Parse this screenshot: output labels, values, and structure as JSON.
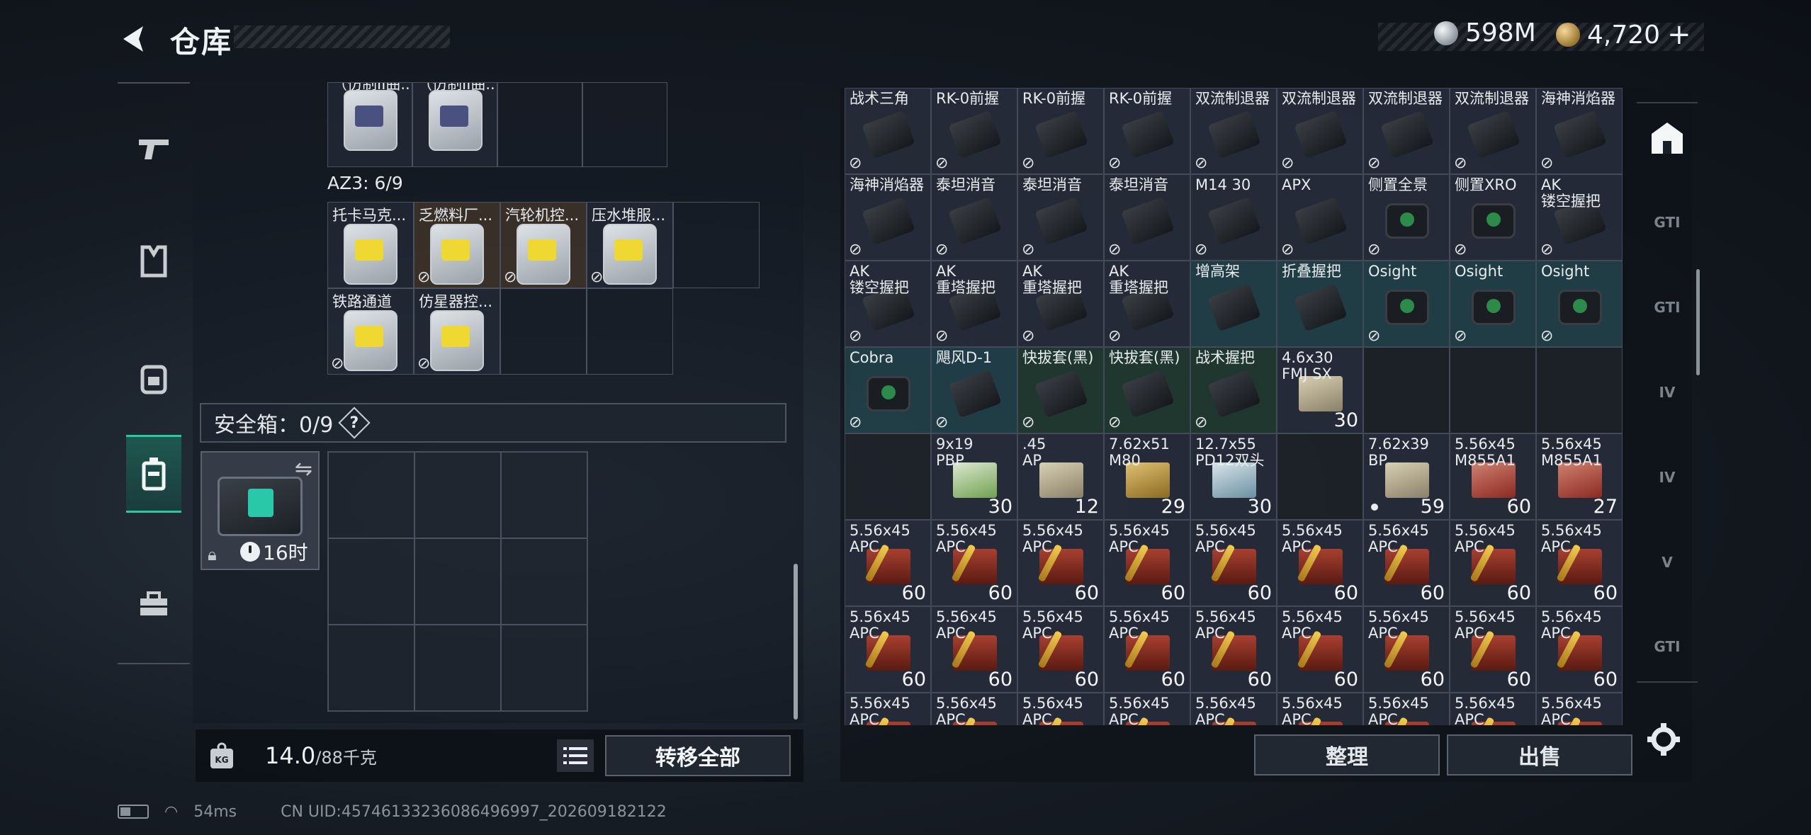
{
  "header": {
    "title": "仓库",
    "currencies": [
      {
        "icon": "silver-coin-icon",
        "value": "598M"
      },
      {
        "icon": "gold-coin-icon",
        "value": "4,720"
      }
    ],
    "add_label": "+"
  },
  "left_rail": {
    "items": [
      {
        "name": "pistol-icon",
        "active": false
      },
      {
        "name": "vest-icon",
        "active": false
      },
      {
        "name": "backpack-icon",
        "active": false
      },
      {
        "name": "safe-case-icon",
        "active": true
      },
      {
        "name": "toolbox-icon",
        "active": false
      }
    ]
  },
  "stash": {
    "top_items": [
      {
        "name": "（仿制II曲...",
        "icon": "keycard-icon",
        "tint": "b",
        "color": "default"
      },
      {
        "name": "（仿制II曲...",
        "icon": "keycard-icon",
        "tint": "b",
        "color": "default"
      }
    ],
    "az3_label": "AZ3: 6/9",
    "az3_items": [
      {
        "name": "托卡马克...",
        "tint": "y",
        "color": "default",
        "nocase": false
      },
      {
        "name": "乏燃料厂...",
        "tint": "y",
        "color": "brown",
        "nocase": true
      },
      {
        "name": "汽轮机控...",
        "tint": "y",
        "color": "brown",
        "nocase": true
      },
      {
        "name": "压水堆服...",
        "tint": "y",
        "color": "default",
        "nocase": true
      },
      {
        "name": "铁路通道",
        "tint": "y",
        "color": "default",
        "nocase": true
      },
      {
        "name": "仿星器控...",
        "tint": "y",
        "color": "default",
        "nocase": true
      }
    ],
    "safe_box": {
      "label": "安全箱：0/9",
      "help": "?",
      "timer": "16时"
    }
  },
  "footer": {
    "weight_current": "14.0",
    "weight_max": "/88千克",
    "transfer_all": "转移全部"
  },
  "inventory": {
    "rows": [
      [
        {
          "name": "战术三角",
          "icon": "part",
          "nocase": true,
          "bg": "default"
        },
        {
          "name": "RK-0前握",
          "icon": "part",
          "nocase": true,
          "bg": "default"
        },
        {
          "name": "RK-0前握",
          "icon": "part",
          "nocase": true,
          "bg": "default"
        },
        {
          "name": "RK-0前握",
          "icon": "part",
          "nocase": true,
          "bg": "default"
        },
        {
          "name": "双流制退器",
          "icon": "part",
          "nocase": true,
          "bg": "default"
        },
        {
          "name": "双流制退器",
          "icon": "part",
          "nocase": true,
          "bg": "default"
        },
        {
          "name": "双流制退器",
          "icon": "part",
          "nocase": true,
          "bg": "default"
        },
        {
          "name": "双流制退器",
          "icon": "part",
          "nocase": true,
          "bg": "default"
        },
        {
          "name": "海神消焰器",
          "icon": "part",
          "nocase": true,
          "bg": "default"
        }
      ],
      [
        {
          "name": "海神消焰器",
          "icon": "part",
          "nocase": true,
          "bg": "default"
        },
        {
          "name": "泰坦消音",
          "icon": "part",
          "nocase": true,
          "bg": "default"
        },
        {
          "name": "泰坦消音",
          "icon": "part",
          "nocase": true,
          "bg": "default"
        },
        {
          "name": "泰坦消音",
          "icon": "part",
          "nocase": true,
          "bg": "default"
        },
        {
          "name": "M14 30",
          "icon": "part",
          "nocase": true,
          "bg": "default"
        },
        {
          "name": "APX",
          "icon": "part",
          "nocase": true,
          "bg": "default"
        },
        {
          "name": "侧置全景",
          "icon": "sight",
          "nocase": true,
          "bg": "default"
        },
        {
          "name": "侧置XRO",
          "icon": "sight",
          "nocase": true,
          "bg": "default"
        },
        {
          "name": "AK\n镂空握把",
          "icon": "part",
          "nocase": true,
          "bg": "default"
        }
      ],
      [
        {
          "name": "AK\n镂空握把",
          "icon": "part",
          "nocase": true,
          "bg": "default"
        },
        {
          "name": "AK\n重塔握把",
          "icon": "part",
          "nocase": true,
          "bg": "default"
        },
        {
          "name": "AK\n重塔握把",
          "icon": "part",
          "nocase": true,
          "bg": "default"
        },
        {
          "name": "AK\n重塔握把",
          "icon": "part",
          "nocase": true,
          "bg": "default"
        },
        {
          "name": "增高架",
          "icon": "part",
          "nocase": false,
          "bg": "teal"
        },
        {
          "name": "折叠握把",
          "icon": "part",
          "nocase": false,
          "bg": "teal"
        },
        {
          "name": "Osight",
          "icon": "sight",
          "nocase": true,
          "bg": "teal"
        },
        {
          "name": "Osight",
          "icon": "sight",
          "nocase": true,
          "bg": "teal"
        },
        {
          "name": "Osight",
          "icon": "sight",
          "nocase": true,
          "bg": "teal"
        }
      ],
      [
        {
          "name": "Cobra",
          "icon": "sight",
          "nocase": true,
          "bg": "teal"
        },
        {
          "name": "飓风D-1",
          "icon": "part",
          "nocase": true,
          "bg": "teal"
        },
        {
          "name": "快拔套(黑)",
          "icon": "part",
          "nocase": true,
          "bg": "green"
        },
        {
          "name": "快拔套(黑)",
          "icon": "part",
          "nocase": true,
          "bg": "green"
        },
        {
          "name": "战术握把",
          "icon": "part",
          "nocase": true,
          "bg": "green"
        },
        {
          "name": "4.6x30\nFMJ SX",
          "icon": "ammo-box",
          "qty": "30",
          "bg": "default"
        },
        {
          "empty": true
        },
        {
          "empty": true
        },
        {
          "empty": true
        }
      ],
      [
        {
          "empty": true
        },
        {
          "name": "9x19\nPBP",
          "icon": "ammo-green",
          "qty": "30",
          "bg": "default"
        },
        {
          "name": ".45\nAP",
          "icon": "ammo-box",
          "qty": "12",
          "bg": "default"
        },
        {
          "name": "7.62x51\nM80",
          "icon": "ammo-tan",
          "qty": "29",
          "bg": "default"
        },
        {
          "name": "12.7x55\nPD12双头",
          "icon": "ammo-blue",
          "qty": "30",
          "bg": "default"
        },
        {
          "empty": true
        },
        {
          "name": "7.62x39\nBP",
          "icon": "ammo-box",
          "qty": "59",
          "dot": true,
          "bg": "default"
        },
        {
          "name": "5.56x45\nM855A1",
          "icon": "ammo-rb",
          "qty": "60",
          "bg": "default"
        },
        {
          "name": "5.56x45\nM855A1",
          "icon": "ammo-rb",
          "qty": "27",
          "bg": "default"
        }
      ],
      [
        {
          "name": "5.56x45\nAPC",
          "icon": "ammo-red",
          "qty": "60",
          "bg": "default"
        },
        {
          "name": "5.56x45\nAPC",
          "icon": "ammo-red",
          "qty": "60",
          "bg": "default"
        },
        {
          "name": "5.56x45\nAPC",
          "icon": "ammo-red",
          "qty": "60",
          "bg": "default"
        },
        {
          "name": "5.56x45\nAPC",
          "icon": "ammo-red",
          "qty": "60",
          "bg": "default"
        },
        {
          "name": "5.56x45\nAPC",
          "icon": "ammo-red",
          "qty": "60",
          "bg": "default"
        },
        {
          "name": "5.56x45\nAPC",
          "icon": "ammo-red",
          "qty": "60",
          "bg": "default"
        },
        {
          "name": "5.56x45\nAPC",
          "icon": "ammo-red",
          "qty": "60",
          "bg": "default"
        },
        {
          "name": "5.56x45\nAPC",
          "icon": "ammo-red",
          "qty": "60",
          "bg": "default"
        },
        {
          "name": "5.56x45\nAPC",
          "icon": "ammo-red",
          "qty": "60",
          "bg": "default"
        }
      ],
      [
        {
          "name": "5.56x45\nAPC",
          "icon": "ammo-red",
          "qty": "60",
          "bg": "default"
        },
        {
          "name": "5.56x45\nAPC",
          "icon": "ammo-red",
          "qty": "60",
          "bg": "default"
        },
        {
          "name": "5.56x45\nAPC",
          "icon": "ammo-red",
          "qty": "60",
          "bg": "default"
        },
        {
          "name": "5.56x45\nAPC",
          "icon": "ammo-red",
          "qty": "60",
          "bg": "default"
        },
        {
          "name": "5.56x45\nAPC",
          "icon": "ammo-red",
          "qty": "60",
          "bg": "default"
        },
        {
          "name": "5.56x45\nAPC",
          "icon": "ammo-red",
          "qty": "60",
          "bg": "default"
        },
        {
          "name": "5.56x45\nAPC",
          "icon": "ammo-red",
          "qty": "60",
          "bg": "default"
        },
        {
          "name": "5.56x45\nAPC",
          "icon": "ammo-red",
          "qty": "60",
          "bg": "default"
        },
        {
          "name": "5.56x45\nAPC",
          "icon": "ammo-red",
          "qty": "60",
          "bg": "default"
        }
      ],
      [
        {
          "name": "5.56x45\nAPC",
          "icon": "ammo-red",
          "bg": "default"
        },
        {
          "name": "5.56x45\nAPC",
          "icon": "ammo-red",
          "bg": "default"
        },
        {
          "name": "5.56x45\nAPC",
          "icon": "ammo-red",
          "bg": "default"
        },
        {
          "name": "5.56x45\nAPC",
          "icon": "ammo-red",
          "bg": "default"
        },
        {
          "name": "5.56x45\nAPC",
          "icon": "ammo-red",
          "bg": "default"
        },
        {
          "name": "5.56x45\nAPC",
          "icon": "ammo-red",
          "bg": "default"
        },
        {
          "name": "5.56x45\nAPC",
          "icon": "ammo-red",
          "bg": "default"
        },
        {
          "name": "5.56x45\nAPC",
          "icon": "ammo-red",
          "bg": "default"
        },
        {
          "name": "5.56x45\nAPC",
          "icon": "ammo-red",
          "bg": "default"
        }
      ]
    ],
    "sort_label": "整理",
    "sell_label": "出售"
  },
  "right_rail": {
    "items": [
      {
        "name": "stash-home-icon",
        "label": "",
        "active": true
      },
      {
        "name": "gti-case-icon",
        "label": "GTI",
        "active": false
      },
      {
        "name": "gti-gun-icon",
        "label": "GTI",
        "active": false
      },
      {
        "name": "iv-medkit-icon",
        "label": "IV",
        "active": false
      },
      {
        "name": "iv-folder-icon",
        "label": "IV",
        "active": false
      },
      {
        "name": "v-tools-icon",
        "label": "V",
        "active": false
      },
      {
        "name": "gti-vehicle-icon",
        "label": "GTI",
        "active": false
      }
    ]
  },
  "status": {
    "ping": "54ms",
    "uid": "CN UID:45746133236086496997_202609182122"
  },
  "colors": {
    "accent": "#26c9a0",
    "panel": "#1a2028"
  }
}
